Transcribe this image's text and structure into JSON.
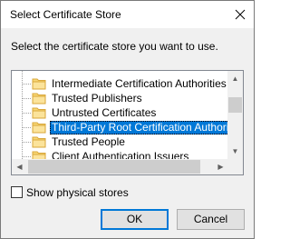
{
  "dialog": {
    "title": "Select Certificate Store",
    "prompt": "Select the certificate store you want to use."
  },
  "tree": {
    "items": [
      {
        "label": "Intermediate Certification Authorities",
        "selected": false
      },
      {
        "label": "Trusted Publishers",
        "selected": false
      },
      {
        "label": "Untrusted Certificates",
        "selected": false
      },
      {
        "label": "Third-Party Root Certification Authorities",
        "selected": true
      },
      {
        "label": "Trusted People",
        "selected": false
      },
      {
        "label": "Client Authentication Issuers",
        "selected": false
      }
    ]
  },
  "options": {
    "show_physical_label": "Show physical stores",
    "show_physical_checked": false
  },
  "buttons": {
    "ok_label": "OK",
    "cancel_label": "Cancel"
  },
  "colors": {
    "selection": "#0078d7",
    "dialog_bg": "#f0f0f0",
    "folder": "#f8d775"
  },
  "icons": {
    "close": "close-icon",
    "folder": "folder-icon"
  }
}
